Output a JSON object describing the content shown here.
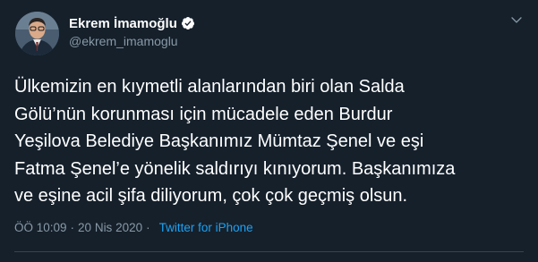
{
  "author": {
    "display_name": "Ekrem İmamoğlu",
    "handle": "@ekrem_imamoglu",
    "verified_icon": "verified-badge-icon",
    "avatar_icon": "profile-photo"
  },
  "tweet": {
    "lines": [
      "Ülkemizin en kıymetli alanlarından biri olan Salda",
      "Gölü’nün korunması için mücadele eden Burdur",
      "Yeşilova  Belediye Başkanımız Mümtaz Şenel ve eşi",
      "Fatma Şenel’e yönelik saldırıyı kınıyorum. Başkanımıza",
      "ve eşine acil şifa diliyorum, çok çok geçmiş olsun."
    ],
    "time": "ÖÖ 10:09",
    "separator": "·",
    "date": "20 Nis 2020",
    "source": "Twitter for iPhone"
  },
  "colors": {
    "background": "#15202b",
    "text": "#ffffff",
    "muted": "#8899a6",
    "accent": "#1da1f2"
  },
  "menu": {
    "icon": "chevron-down-icon"
  }
}
